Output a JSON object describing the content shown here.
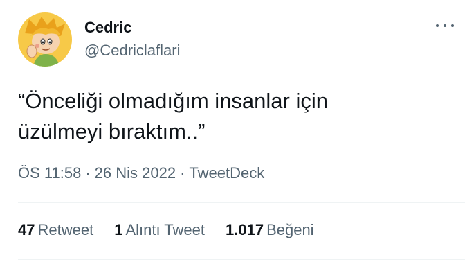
{
  "author": {
    "display_name": "Cedric",
    "handle": "@Cedriclaflari"
  },
  "tweet": {
    "text": "“Önceliği olmadığım insanlar için\nüzülmeyi bıraktım..”",
    "time": "ÖS 11:58",
    "date": "26 Nis 2022",
    "source": "TweetDeck",
    "separator": "·"
  },
  "stats": {
    "retweets": {
      "count": "47",
      "label": "Retweet"
    },
    "quotes": {
      "count": "1",
      "label": "Alıntı Tweet"
    },
    "likes": {
      "count": "1.017",
      "label": "Beğeni"
    }
  },
  "icons": {
    "more": "more-options-icon",
    "avatar": "cartoon-boy-avatar"
  },
  "colors": {
    "text": "#0f1419",
    "secondary": "#536471",
    "divider": "#eff3f4",
    "avatar_bg": "#f7c948"
  }
}
